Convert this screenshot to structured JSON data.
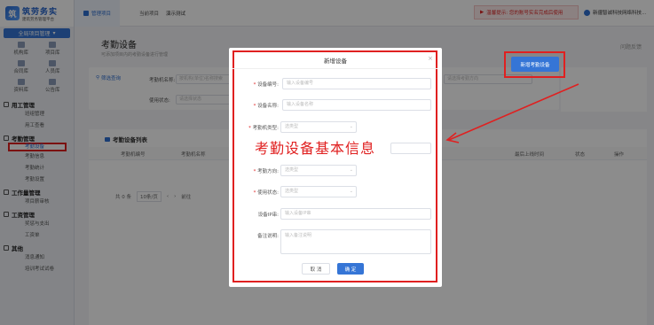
{
  "logo": {
    "title": "筑劳务实",
    "subtitle": "建筑劳务管理平台"
  },
  "sidebar": {
    "project_button": "全局项目管理",
    "quick_items": [
      "机构库",
      "项目库",
      "合同库",
      "人员库",
      "资料库",
      "公告库"
    ],
    "groups": [
      {
        "title": "用工管理",
        "items": [
          "班组管理",
          "用工查看"
        ]
      },
      {
        "title": "考勤管理",
        "items": [
          "考勤设备",
          "考勤信息",
          "考勤统计",
          "考勤设置"
        ],
        "active_index": 0
      },
      {
        "title": "工作量管理",
        "items": [
          "项目薪审核"
        ]
      },
      {
        "title": "工资管理",
        "items": [
          "奖惩与支出",
          "工资单"
        ]
      },
      {
        "title": "其他",
        "items": [
          "消息通知",
          "培训考试试卷"
        ]
      }
    ]
  },
  "topbar": {
    "home_tab": "管理项目",
    "current_project_label": "当前项目",
    "current_project_value": "演示测试",
    "notice": "温馨提示: 您的账号实名完成后使用",
    "user": "新疆智诚科技网络科技..."
  },
  "page": {
    "title": "考勤设备",
    "description": "可添加项目内的考勤设备进行管理",
    "feedback": "问题反馈"
  },
  "filter": {
    "link": "筛选查询",
    "org_label": "考勤机名称:",
    "org_placeholder": "按机构(单位)名称搜索",
    "status_label": "使用状态:",
    "status_placeholder": "请选择状态",
    "direction_placeholder": "请选择考勤方向"
  },
  "add_button": "新增考勤设备",
  "list": {
    "title": "考勤设备列表",
    "columns": [
      "考勤机编号",
      "考勤机名称",
      "最后上线时间",
      "状态",
      "操作"
    ],
    "pager_total": "共 0 条",
    "pager_size": "10条/页",
    "pager_goto": "前往"
  },
  "modal": {
    "title": "新增设备",
    "fields": [
      {
        "label": "设备编号:",
        "required": true,
        "placeholder": "输入设备编号",
        "type": "input"
      },
      {
        "label": "设备名称:",
        "required": true,
        "placeholder": "输入设备名称",
        "type": "input"
      },
      {
        "label": "考勤机类型:",
        "required": true,
        "placeholder": "选类型",
        "type": "select"
      },
      {
        "label": "考勤方向:",
        "required": true,
        "placeholder": "选类型",
        "type": "select"
      },
      {
        "label": "使用状态:",
        "required": true,
        "placeholder": "选类型",
        "type": "select"
      },
      {
        "label": "设备IP串:",
        "required": false,
        "placeholder": "输入设备IP串",
        "type": "input"
      },
      {
        "label": "备注说明:",
        "required": false,
        "placeholder": "输入备注说明",
        "type": "textarea"
      }
    ],
    "cancel": "取 消",
    "confirm": "确 定"
  },
  "annotation": "考勤设备基本信息",
  "colors": {
    "accent": "#3575d6",
    "annotation_red": "#e02020"
  }
}
